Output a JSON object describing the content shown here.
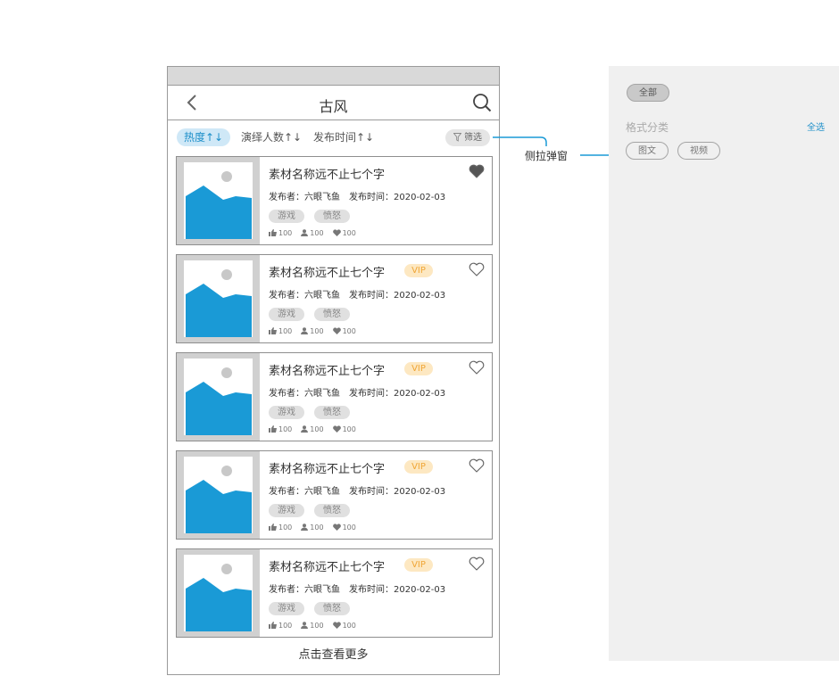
{
  "header": {
    "title": "古风"
  },
  "sort": {
    "hot": "热度↑↓",
    "performers": "演绎人数↑↓",
    "publish_time": "发布时间↑↓",
    "filter": "筛选"
  },
  "cards": [
    {
      "title": "素材名称远不止七个字",
      "vip": "",
      "favorited": true,
      "meta_publisher": "发布者：六眼飞鱼",
      "meta_time": "发布时间：2020-02-03",
      "tags": [
        "游戏",
        "愤怒"
      ],
      "likes": "100",
      "users": "100",
      "hearts": "100"
    },
    {
      "title": "素材名称远不止七个字",
      "vip": "VIP",
      "favorited": false,
      "meta_publisher": "发布者：六眼飞鱼",
      "meta_time": "发布时间：2020-02-03",
      "tags": [
        "游戏",
        "愤怒"
      ],
      "likes": "100",
      "users": "100",
      "hearts": "100"
    },
    {
      "title": "素材名称远不止七个字",
      "vip": "VIP",
      "favorited": false,
      "meta_publisher": "发布者：六眼飞鱼",
      "meta_time": "发布时间：2020-02-03",
      "tags": [
        "游戏",
        "愤怒"
      ],
      "likes": "100",
      "users": "100",
      "hearts": "100"
    },
    {
      "title": "素材名称远不止七个字",
      "vip": "VIP",
      "favorited": false,
      "meta_publisher": "发布者：六眼飞鱼",
      "meta_time": "发布时间：2020-02-03",
      "tags": [
        "游戏",
        "愤怒"
      ],
      "likes": "100",
      "users": "100",
      "hearts": "100"
    },
    {
      "title": "素材名称远不止七个字",
      "vip": "VIP",
      "favorited": false,
      "meta_publisher": "发布者：六眼飞鱼",
      "meta_time": "发布时间：2020-02-03",
      "tags": [
        "游戏",
        "愤怒"
      ],
      "likes": "100",
      "users": "100",
      "hearts": "100"
    }
  ],
  "load_more": "点击查看更多",
  "annotation": {
    "label": "侧拉弹窗"
  },
  "side_panel": {
    "all_chip": "全部",
    "section_title": "格式分类",
    "select_all": "全选",
    "chips": [
      "图文",
      "视频"
    ]
  },
  "colors": {
    "accent": "#1d8fc9",
    "image_blue": "#1a9ad6",
    "vip_bg": "#fde8c2",
    "vip_text": "#f0a637"
  }
}
